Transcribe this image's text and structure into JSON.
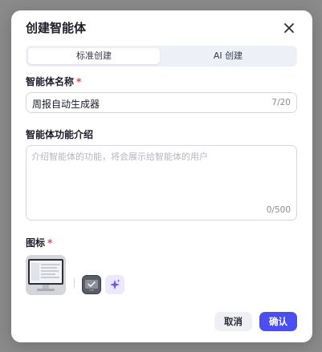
{
  "dialog": {
    "title": "创建智能体",
    "close_icon": "close-icon"
  },
  "tabs": [
    {
      "label": "标准创建",
      "active": true
    },
    {
      "label": "AI 创建",
      "active": false
    }
  ],
  "name_field": {
    "label": "智能体名称",
    "required_mark": "*",
    "value": "周报自动生成器",
    "counter": "7/20"
  },
  "description_field": {
    "label": "智能体功能介绍",
    "placeholder": "介绍智能体的功能，将会展示给智能体的用户",
    "counter": "0/500"
  },
  "icon_field": {
    "label": "图标",
    "required_mark": "*",
    "options": [
      "monitor-image-icon",
      "ai-sparkle-icon"
    ]
  },
  "footer": {
    "cancel_label": "取消",
    "confirm_label": "确认"
  },
  "colors": {
    "accent": "#4b4ff0",
    "required": "#e5484d",
    "ai_icon_bg": "#ece8ff"
  }
}
